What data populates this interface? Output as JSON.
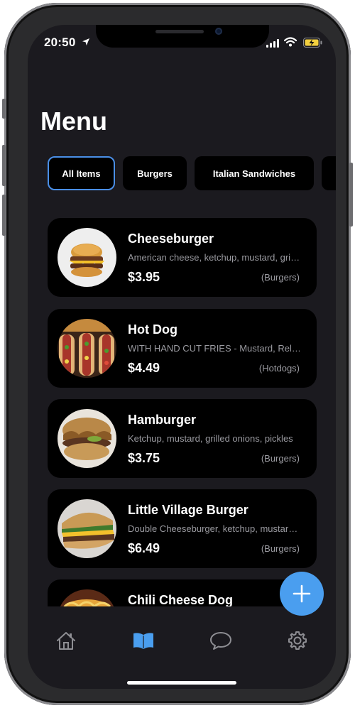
{
  "status_bar": {
    "time": "20:50"
  },
  "header": {
    "title": "Menu"
  },
  "categories": [
    {
      "label": "All Items",
      "selected": true
    },
    {
      "label": "Burgers",
      "selected": false
    },
    {
      "label": "Italian Sandwiches",
      "selected": false
    },
    {
      "label": "",
      "selected": false
    }
  ],
  "items": [
    {
      "name": "Cheeseburger",
      "description": "American cheese, ketchup, mustard, grilled onions, pickles",
      "price": "$3.95",
      "category": "(Burgers)"
    },
    {
      "name": "Hot Dog",
      "description": "WITH HAND CUT FRIES - Mustard, Relish, Onions, Tomato, Pickle, Sport Peppers",
      "price": "$4.49",
      "category": "(Hotdogs)"
    },
    {
      "name": "Hamburger",
      "description": "Ketchup, mustard, grilled onions, pickles",
      "price": "$3.75",
      "category": "(Burgers)"
    },
    {
      "name": "Little Village Burger",
      "description": "Double Cheeseburger, ketchup, mustard, grilled onions",
      "price": "$6.49",
      "category": "(Burgers)"
    },
    {
      "name": "Chili Cheese Dog",
      "description": "",
      "price": "",
      "category": ""
    }
  ],
  "tabbar": {
    "items": [
      "home-icon",
      "book-icon",
      "chat-icon",
      "gear-icon"
    ],
    "active": "book-icon"
  },
  "colors": {
    "accent": "#4a9eef",
    "background": "#1b1a1f",
    "card": "#000000",
    "muted_text": "#9a9aa0"
  }
}
